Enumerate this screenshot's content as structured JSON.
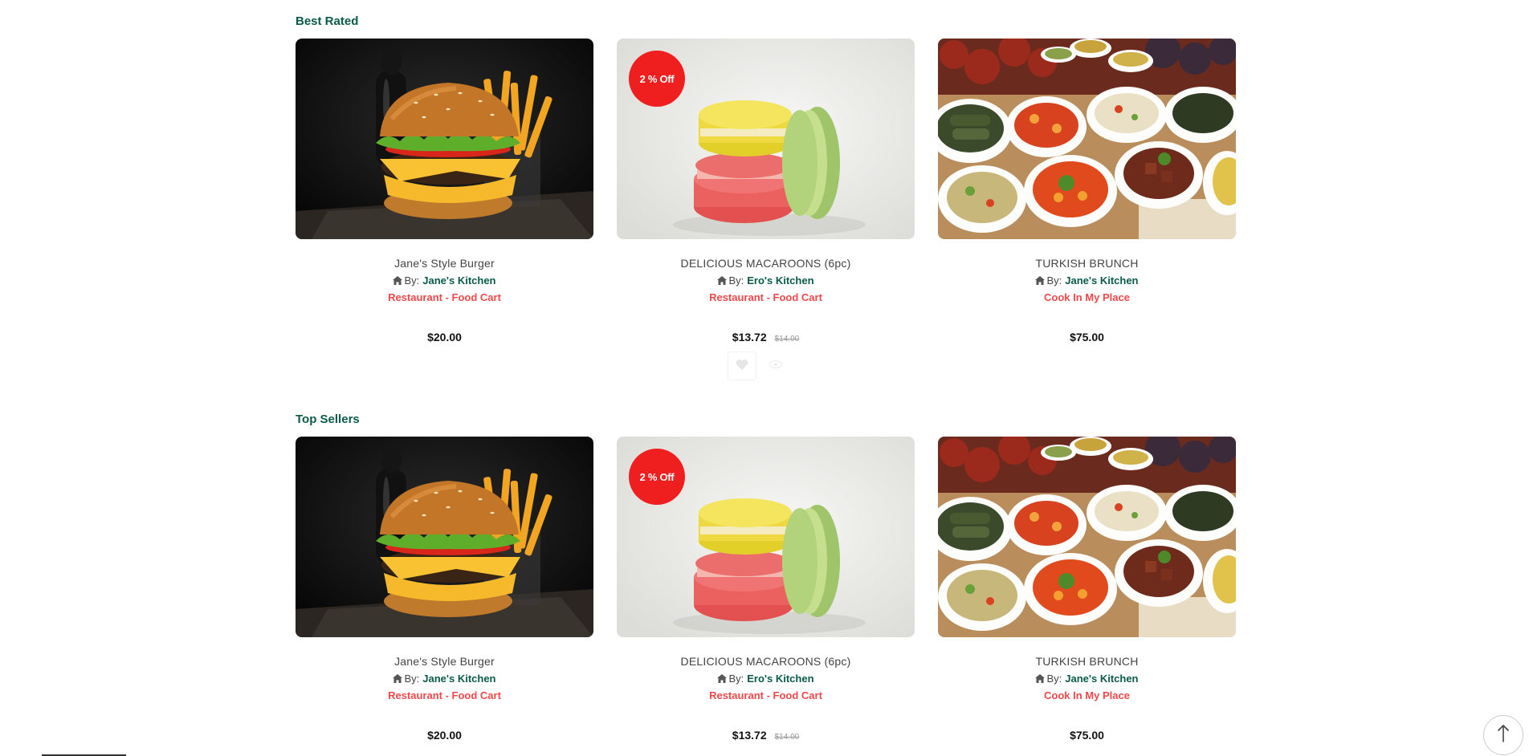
{
  "sections": [
    {
      "title": "Best Rated",
      "products": [
        {
          "name": "Jane's Style Burger",
          "by_label": "By:",
          "vendor": "Jane's Kitchen",
          "category": "Restaurant - Food Cart",
          "price": "$20.00",
          "old_price": "",
          "badge": ""
        },
        {
          "name": "DELICIOUS MACAROONS (6pc)",
          "by_label": "By:",
          "vendor": "Ero's Kitchen",
          "category": "Restaurant - Food Cart",
          "price": "$13.72",
          "old_price": "$14.00",
          "badge": "2 % Off"
        },
        {
          "name": "TURKISH BRUNCH",
          "by_label": "By:",
          "vendor": "Jane's Kitchen",
          "category": "Cook In My Place",
          "price": "$75.00",
          "old_price": "",
          "badge": ""
        }
      ]
    },
    {
      "title": "Top Sellers",
      "products": [
        {
          "name": "Jane's Style Burger",
          "by_label": "By:",
          "vendor": "Jane's Kitchen",
          "category": "Restaurant - Food Cart",
          "price": "$20.00",
          "old_price": "",
          "badge": ""
        },
        {
          "name": "DELICIOUS MACAROONS (6pc)",
          "by_label": "By:",
          "vendor": "Ero's Kitchen",
          "category": "Restaurant - Food Cart",
          "price": "$13.72",
          "old_price": "$14.00",
          "badge": "2 % Off"
        },
        {
          "name": "TURKISH BRUNCH",
          "by_label": "By:",
          "vendor": "Jane's Kitchen",
          "category": "Cook In My Place",
          "price": "$75.00",
          "old_price": "",
          "badge": ""
        }
      ]
    }
  ],
  "icons": {
    "vendor": "home-icon",
    "wishlist": "heart-icon",
    "quick_view": "eye-icon",
    "scroll_top": "arrow-up-icon"
  },
  "colors": {
    "heading": "#0a5a4a",
    "category": "#f0484b",
    "badge": "#f01f1f"
  }
}
